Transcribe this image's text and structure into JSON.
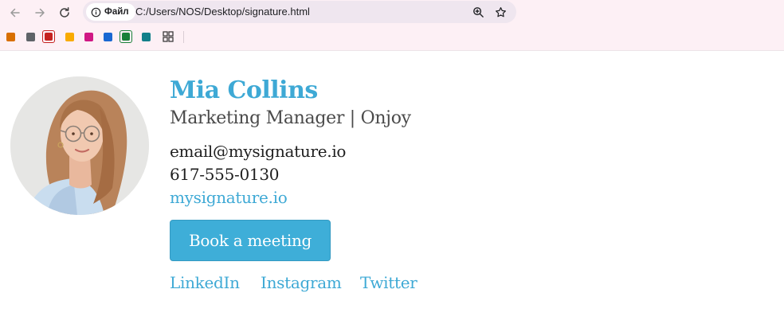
{
  "browser": {
    "site_chip_label": "Файл",
    "url": "C:/Users/NOS/Desktop/signature.html",
    "bookmarks": [
      {
        "icon": "orange-bookmark-icon",
        "color": "#d86f00"
      },
      {
        "icon": "gray-bookmark-icon",
        "color": "#5f6368"
      },
      {
        "icon": "red-bookmark-icon",
        "color": "#c5221f"
      },
      {
        "icon": "yellow-bookmark-icon",
        "color": "#f9ab00"
      },
      {
        "icon": "pink-bookmark-icon",
        "color": "#d01884"
      },
      {
        "icon": "blue-bookmark-icon",
        "color": "#1967d2"
      },
      {
        "icon": "green-bookmark-icon",
        "color": "#188038"
      },
      {
        "icon": "teal-bookmark-icon",
        "color": "#12808a"
      }
    ]
  },
  "signature": {
    "name": "Mia Collins",
    "role": "Marketing Manager | Onjoy",
    "email": "email@mysignature.io",
    "phone": "617-555-0130",
    "website": "mysignature.io",
    "cta_label": "Book a meeting",
    "socials": [
      {
        "label": "LinkedIn"
      },
      {
        "label": "Instagram"
      },
      {
        "label": "Twitter"
      }
    ],
    "accent_color": "#3ea9d5"
  }
}
